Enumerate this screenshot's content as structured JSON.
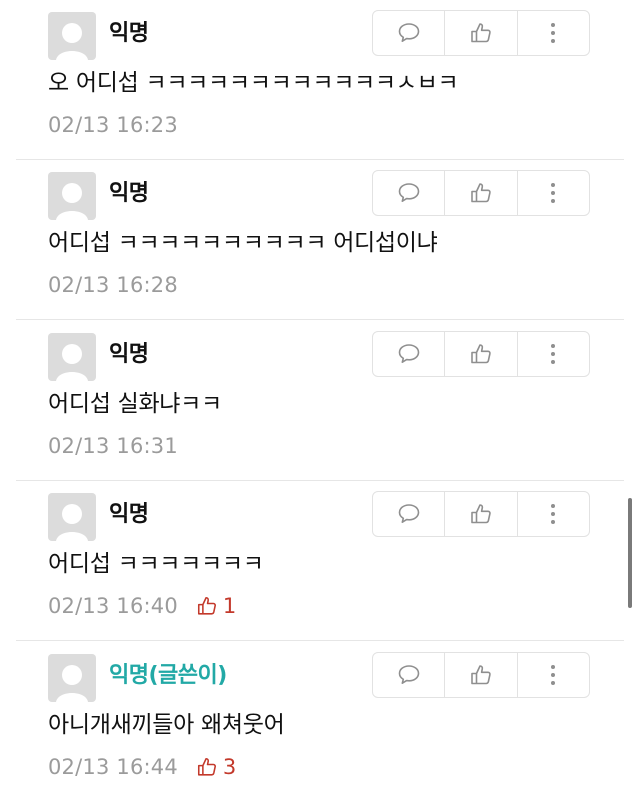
{
  "colors": {
    "writer_name": "#22a9a6",
    "like_count": "#c3392b",
    "timestamp": "#9b9b9b",
    "divider": "#e6e6e6"
  },
  "comments": [
    {
      "author": "익명",
      "text": "오 어디섭 ㅋㅋㅋㅋㅋㅋㅋㅋㅋㅋㅋㅋㅅㅂㅋ",
      "time": "02/13 16:23",
      "likes": ""
    },
    {
      "author": "익명",
      "text": "어디섭 ㅋㅋㅋㅋㅋㅋㅋㅋㅋㅋ 어디섭이냐",
      "time": "02/13 16:28",
      "likes": ""
    },
    {
      "author": "익명",
      "text": "어디섭 실화냐ㅋㅋ",
      "time": "02/13 16:31",
      "likes": ""
    },
    {
      "author": "익명",
      "text": "어디섭 ㅋㅋㅋㅋㅋㅋㅋ",
      "time": "02/13 16:40",
      "likes": "1"
    },
    {
      "author": "익명(글쓴이)",
      "text": "아니개새끼들아 왜쳐웃어",
      "time": "02/13 16:44",
      "likes": "3"
    }
  ],
  "icons": {
    "reply": "speech-bubble-icon",
    "like": "thumbs-up-icon",
    "more": "more-vertical-icon"
  }
}
